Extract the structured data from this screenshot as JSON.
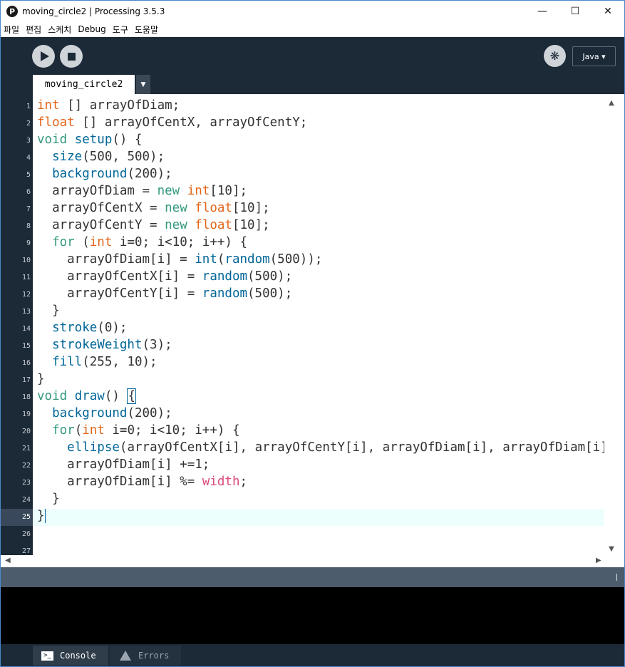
{
  "window": {
    "title": "moving_circle2 | Processing 3.5.3",
    "app_icon_glyph": "P",
    "controls": {
      "minimize": "—",
      "maximize": "☐",
      "close": "✕"
    }
  },
  "menu": [
    "파일",
    "편집",
    "스케치",
    "Debug",
    "도구",
    "도움말"
  ],
  "toolbar": {
    "run_icon": "play-icon",
    "stop_icon": "stop-icon",
    "debug_glyph": "❋",
    "mode_label": "Java ▾"
  },
  "tabs": {
    "active": "moving_circle2",
    "menu_glyph": "▼"
  },
  "editor": {
    "line_numbers": [
      "1",
      "2",
      "3",
      "4",
      "5",
      "6",
      "7",
      "8",
      "9",
      "10",
      "11",
      "12",
      "13",
      "14",
      "15",
      "16",
      "17",
      "18",
      "19",
      "20",
      "21",
      "22",
      "23",
      "24",
      "25",
      "26",
      "27"
    ],
    "current_line": 25,
    "lines": [
      [
        {
          "t": "type",
          "s": "int"
        },
        {
          "t": "plain",
          "s": " [] arrayOfDiam;"
        }
      ],
      [
        {
          "t": "type",
          "s": "float"
        },
        {
          "t": "plain",
          "s": " [] arrayOfCentX, arrayOfCentY;"
        }
      ],
      [
        {
          "t": "kw",
          "s": "void"
        },
        {
          "t": "plain",
          "s": " "
        },
        {
          "t": "fn",
          "s": "setup"
        },
        {
          "t": "plain",
          "s": "() {"
        }
      ],
      [
        {
          "t": "plain",
          "s": "  "
        },
        {
          "t": "fn",
          "s": "size"
        },
        {
          "t": "plain",
          "s": "(500, 500);"
        }
      ],
      [
        {
          "t": "plain",
          "s": "  "
        },
        {
          "t": "fn",
          "s": "background"
        },
        {
          "t": "plain",
          "s": "(200);"
        }
      ],
      [
        {
          "t": "plain",
          "s": "  arrayOfDiam = "
        },
        {
          "t": "kw",
          "s": "new"
        },
        {
          "t": "plain",
          "s": " "
        },
        {
          "t": "type",
          "s": "int"
        },
        {
          "t": "plain",
          "s": "[10];"
        }
      ],
      [
        {
          "t": "plain",
          "s": "  arrayOfCentX = "
        },
        {
          "t": "kw",
          "s": "new"
        },
        {
          "t": "plain",
          "s": " "
        },
        {
          "t": "type",
          "s": "float"
        },
        {
          "t": "plain",
          "s": "[10];"
        }
      ],
      [
        {
          "t": "plain",
          "s": "  arrayOfCentY = "
        },
        {
          "t": "kw",
          "s": "new"
        },
        {
          "t": "plain",
          "s": " "
        },
        {
          "t": "type",
          "s": "float"
        },
        {
          "t": "plain",
          "s": "[10];"
        }
      ],
      [
        {
          "t": "plain",
          "s": "  "
        },
        {
          "t": "kw",
          "s": "for"
        },
        {
          "t": "plain",
          "s": " ("
        },
        {
          "t": "type",
          "s": "int"
        },
        {
          "t": "plain",
          "s": " i=0; i<10; i++) {"
        }
      ],
      [
        {
          "t": "plain",
          "s": "    arrayOfDiam[i] = "
        },
        {
          "t": "fn",
          "s": "int"
        },
        {
          "t": "plain",
          "s": "("
        },
        {
          "t": "fn",
          "s": "random"
        },
        {
          "t": "plain",
          "s": "(500));"
        }
      ],
      [
        {
          "t": "plain",
          "s": "    arrayOfCentX[i] = "
        },
        {
          "t": "fn",
          "s": "random"
        },
        {
          "t": "plain",
          "s": "(500);"
        }
      ],
      [
        {
          "t": "plain",
          "s": "    arrayOfCentY[i] = "
        },
        {
          "t": "fn",
          "s": "random"
        },
        {
          "t": "plain",
          "s": "(500);"
        }
      ],
      [
        {
          "t": "plain",
          "s": "  }"
        }
      ],
      [
        {
          "t": "plain",
          "s": "  "
        },
        {
          "t": "fn",
          "s": "stroke"
        },
        {
          "t": "plain",
          "s": "(0);"
        }
      ],
      [
        {
          "t": "plain",
          "s": "  "
        },
        {
          "t": "fn",
          "s": "strokeWeight"
        },
        {
          "t": "plain",
          "s": "(3);"
        }
      ],
      [
        {
          "t": "plain",
          "s": "  "
        },
        {
          "t": "fn",
          "s": "fill"
        },
        {
          "t": "plain",
          "s": "(255, 10);"
        }
      ],
      [
        {
          "t": "plain",
          "s": "}"
        }
      ],
      [
        {
          "t": "kw",
          "s": "void"
        },
        {
          "t": "plain",
          "s": " "
        },
        {
          "t": "fn",
          "s": "draw"
        },
        {
          "t": "plain",
          "s": "() "
        },
        {
          "t": "box",
          "s": "{"
        }
      ],
      [
        {
          "t": "plain",
          "s": "  "
        },
        {
          "t": "fn",
          "s": "background"
        },
        {
          "t": "plain",
          "s": "(200);"
        }
      ],
      [
        {
          "t": "plain",
          "s": "  "
        },
        {
          "t": "kw",
          "s": "for"
        },
        {
          "t": "plain",
          "s": "("
        },
        {
          "t": "type",
          "s": "int"
        },
        {
          "t": "plain",
          "s": " i=0; i<10; i++) {"
        }
      ],
      [
        {
          "t": "plain",
          "s": "    "
        },
        {
          "t": "fn",
          "s": "ellipse"
        },
        {
          "t": "plain",
          "s": "(arrayOfCentX[i], arrayOfCentY[i], arrayOfDiam[i], arrayOfDiam[i]);"
        }
      ],
      [
        {
          "t": "plain",
          "s": "    arrayOfDiam[i] +=1;"
        }
      ],
      [
        {
          "t": "plain",
          "s": "    arrayOfDiam[i] %= "
        },
        {
          "t": "var",
          "s": "width"
        },
        {
          "t": "plain",
          "s": ";"
        }
      ],
      [
        {
          "t": "plain",
          "s": "  }"
        }
      ],
      [
        {
          "t": "plain",
          "s": "}"
        }
      ],
      [],
      []
    ]
  },
  "scroll": {
    "up": "▲",
    "down": "▼",
    "left": "◀",
    "right": "▶"
  },
  "console_tabs": {
    "console_label": "Console",
    "console_glyph": ">_",
    "errors_label": "Errors"
  }
}
